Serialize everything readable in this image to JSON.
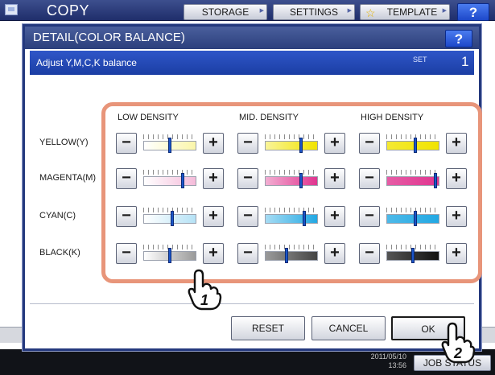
{
  "topbar": {
    "title": "COPY",
    "storage_label": "STORAGE",
    "settings_label": "SETTINGS",
    "template_label": "TEMPLATE",
    "help_label": "?"
  },
  "dialog": {
    "title": "DETAIL(COLOR BALANCE)",
    "help_label": "?",
    "subtitle": "Adjust Y,M,C,K balance",
    "set_label": "SET",
    "set_value": "1",
    "columns": [
      "LOW DENSITY",
      "MID. DENSITY",
      "HIGH DENSITY"
    ],
    "rows": [
      {
        "label": "YELLOW(Y)",
        "levels": [
          0.5,
          0.7,
          0.55
        ]
      },
      {
        "label": "MAGENTA(M)",
        "levels": [
          0.75,
          0.7,
          0.95
        ]
      },
      {
        "label": "CYAN(C)",
        "levels": [
          0.55,
          0.75,
          0.55
        ]
      },
      {
        "label": "BLACK(K)",
        "levels": [
          0.5,
          0.4,
          0.5
        ]
      }
    ],
    "buttons": {
      "reset": "RESET",
      "cancel": "CANCEL",
      "ok": "OK"
    },
    "plus_label": "+",
    "minus_label": "−"
  },
  "callouts": [
    "1",
    "2"
  ],
  "bottombar": {
    "date": "2011/05/10",
    "time": "13:56",
    "job_status": "JOB STATUS"
  },
  "colors": {
    "yellow": "#f1e400",
    "magenta": "#e0348f",
    "cyan": "#22a8e3",
    "black": "#1a1a1a",
    "highlight": "#e8957a"
  }
}
